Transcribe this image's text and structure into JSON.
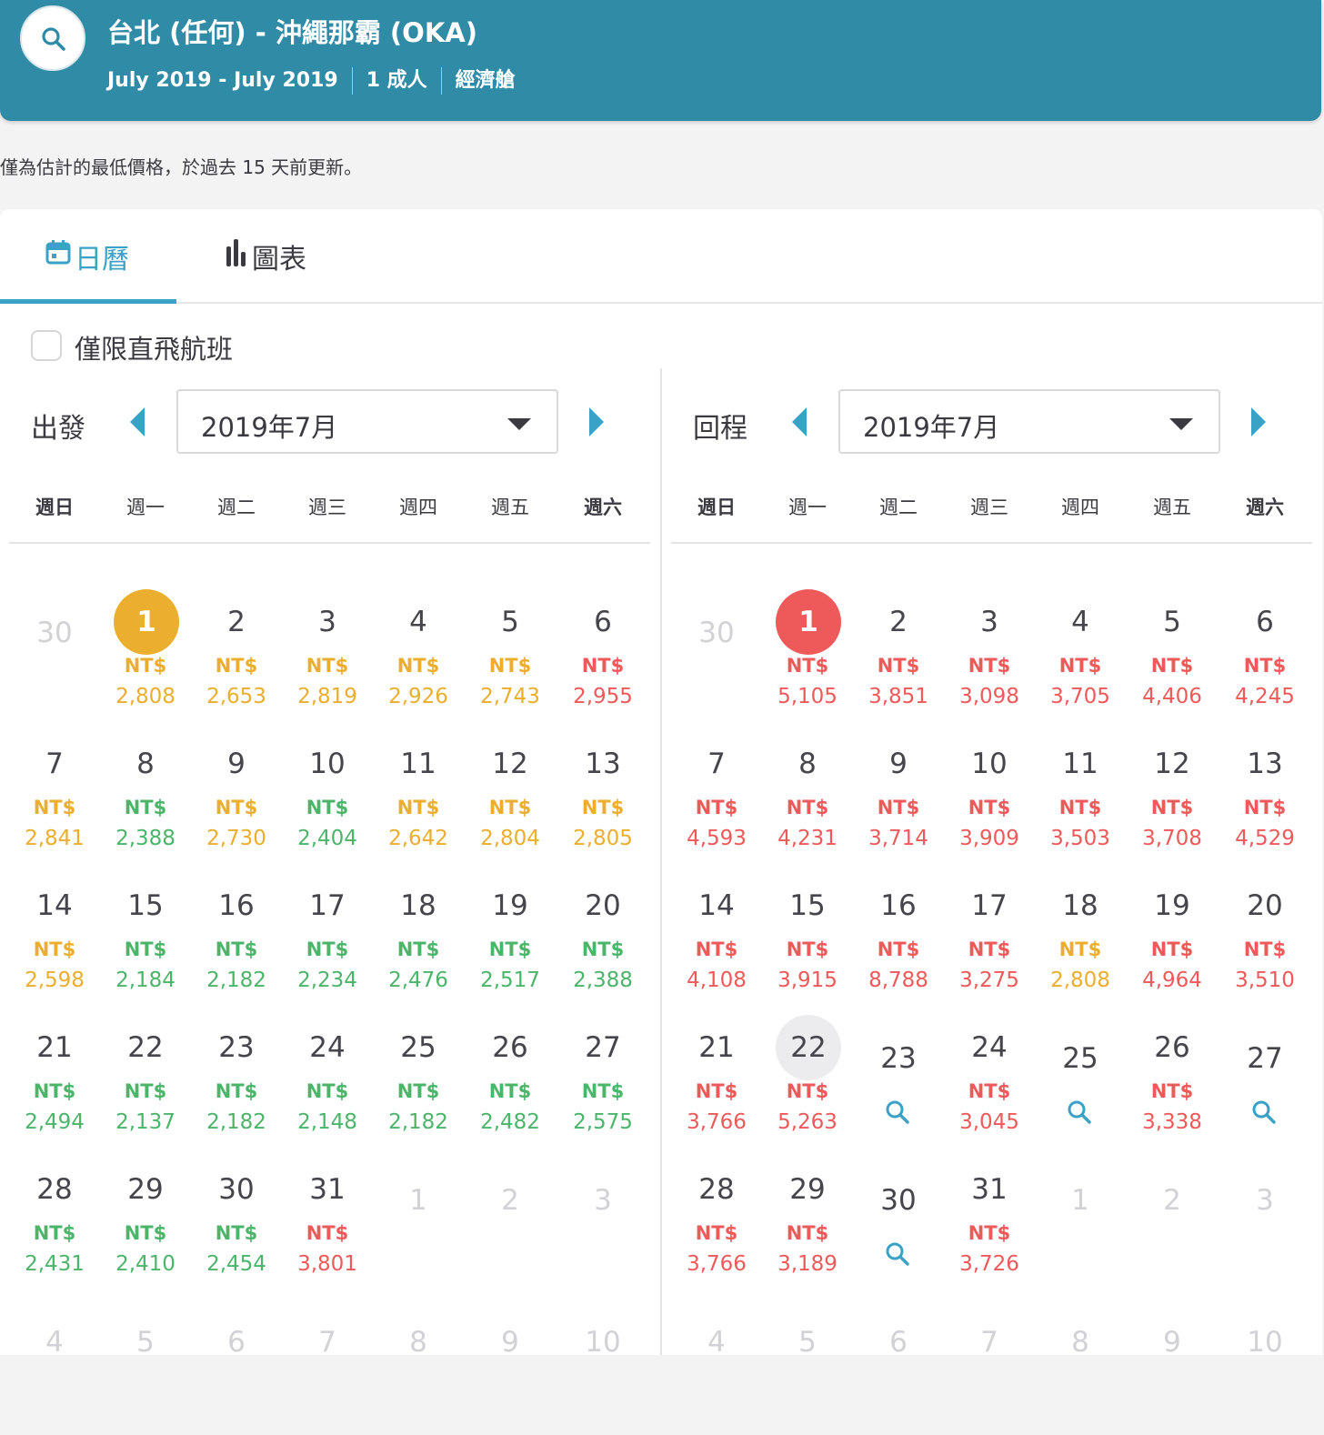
{
  "header": {
    "route": "台北 (任何) - 沖繩那霸 (OKA)",
    "dates": "July 2019 - July 2019",
    "passengers": "1 成人",
    "cabin": "經濟艙"
  },
  "notice": "僅為估計的最低價格，於過去 15 天前更新。",
  "tabs": {
    "calendar": "日曆",
    "chart": "圖表"
  },
  "filter": {
    "direct_only": "僅限直飛航班",
    "checked": false
  },
  "colors": {
    "header_bg": "#2f8ba6",
    "accent": "#3aa2c6",
    "low": "#4bb56a",
    "mid": "#ecae2e",
    "high": "#ee5a5a"
  },
  "weekdays": [
    "週日",
    "週一",
    "週二",
    "週三",
    "週四",
    "週五",
    "週六"
  ],
  "calendars": [
    {
      "label": "出發",
      "month": "2019年7月",
      "selected_color": "#ecae2e",
      "weeks": [
        [
          {
            "d": "30",
            "o": 1
          },
          {
            "d": "1",
            "p": "2,808",
            "c": "o",
            "s": 1
          },
          {
            "d": "2",
            "p": "2,653",
            "c": "o"
          },
          {
            "d": "3",
            "p": "2,819",
            "c": "o"
          },
          {
            "d": "4",
            "p": "2,926",
            "c": "o"
          },
          {
            "d": "5",
            "p": "2,743",
            "c": "o"
          },
          {
            "d": "6",
            "p": "2,955",
            "c": "r"
          }
        ],
        [
          {
            "d": "7",
            "p": "2,841",
            "c": "o"
          },
          {
            "d": "8",
            "p": "2,388",
            "c": "g"
          },
          {
            "d": "9",
            "p": "2,730",
            "c": "o"
          },
          {
            "d": "10",
            "p": "2,404",
            "c": "g"
          },
          {
            "d": "11",
            "p": "2,642",
            "c": "o"
          },
          {
            "d": "12",
            "p": "2,804",
            "c": "o"
          },
          {
            "d": "13",
            "p": "2,805",
            "c": "o"
          }
        ],
        [
          {
            "d": "14",
            "p": "2,598",
            "c": "o"
          },
          {
            "d": "15",
            "p": "2,184",
            "c": "g"
          },
          {
            "d": "16",
            "p": "2,182",
            "c": "g"
          },
          {
            "d": "17",
            "p": "2,234",
            "c": "g"
          },
          {
            "d": "18",
            "p": "2,476",
            "c": "g"
          },
          {
            "d": "19",
            "p": "2,517",
            "c": "g"
          },
          {
            "d": "20",
            "p": "2,388",
            "c": "g"
          }
        ],
        [
          {
            "d": "21",
            "p": "2,494",
            "c": "g"
          },
          {
            "d": "22",
            "p": "2,137",
            "c": "g"
          },
          {
            "d": "23",
            "p": "2,182",
            "c": "g"
          },
          {
            "d": "24",
            "p": "2,148",
            "c": "g"
          },
          {
            "d": "25",
            "p": "2,182",
            "c": "g"
          },
          {
            "d": "26",
            "p": "2,482",
            "c": "g"
          },
          {
            "d": "27",
            "p": "2,575",
            "c": "g"
          }
        ],
        [
          {
            "d": "28",
            "p": "2,431",
            "c": "g"
          },
          {
            "d": "29",
            "p": "2,410",
            "c": "g"
          },
          {
            "d": "30",
            "p": "2,454",
            "c": "g"
          },
          {
            "d": "31",
            "p": "3,801",
            "c": "r"
          },
          {
            "d": "1",
            "o": 1
          },
          {
            "d": "2",
            "o": 1
          },
          {
            "d": "3",
            "o": 1
          }
        ],
        [
          {
            "d": "4",
            "o": 1
          },
          {
            "d": "5",
            "o": 1
          },
          {
            "d": "6",
            "o": 1
          },
          {
            "d": "7",
            "o": 1
          },
          {
            "d": "8",
            "o": 1
          },
          {
            "d": "9",
            "o": 1
          },
          {
            "d": "10",
            "o": 1
          }
        ]
      ]
    },
    {
      "label": "回程",
      "month": "2019年7月",
      "selected_color": "#ee5a5a",
      "weeks": [
        [
          {
            "d": "30",
            "o": 1
          },
          {
            "d": "1",
            "p": "5,105",
            "c": "r",
            "s": 1
          },
          {
            "d": "2",
            "p": "3,851",
            "c": "r"
          },
          {
            "d": "3",
            "p": "3,098",
            "c": "r"
          },
          {
            "d": "4",
            "p": "3,705",
            "c": "r"
          },
          {
            "d": "5",
            "p": "4,406",
            "c": "r"
          },
          {
            "d": "6",
            "p": "4,245",
            "c": "r"
          }
        ],
        [
          {
            "d": "7",
            "p": "4,593",
            "c": "r"
          },
          {
            "d": "8",
            "p": "4,231",
            "c": "r"
          },
          {
            "d": "9",
            "p": "3,714",
            "c": "r"
          },
          {
            "d": "10",
            "p": "3,909",
            "c": "r"
          },
          {
            "d": "11",
            "p": "3,503",
            "c": "r"
          },
          {
            "d": "12",
            "p": "3,708",
            "c": "r"
          },
          {
            "d": "13",
            "p": "4,529",
            "c": "r"
          }
        ],
        [
          {
            "d": "14",
            "p": "4,108",
            "c": "r"
          },
          {
            "d": "15",
            "p": "3,915",
            "c": "r"
          },
          {
            "d": "16",
            "p": "8,788",
            "c": "r"
          },
          {
            "d": "17",
            "p": "3,275",
            "c": "r"
          },
          {
            "d": "18",
            "p": "2,808",
            "c": "o"
          },
          {
            "d": "19",
            "p": "4,964",
            "c": "r"
          },
          {
            "d": "20",
            "p": "3,510",
            "c": "r"
          }
        ],
        [
          {
            "d": "21",
            "p": "3,766",
            "c": "r"
          },
          {
            "d": "22",
            "p": "5,263",
            "c": "r",
            "h": 1
          },
          {
            "d": "23",
            "q": 1
          },
          {
            "d": "24",
            "p": "3,045",
            "c": "r"
          },
          {
            "d": "25",
            "q": 1
          },
          {
            "d": "26",
            "p": "3,338",
            "c": "r"
          },
          {
            "d": "27",
            "q": 1
          }
        ],
        [
          {
            "d": "28",
            "p": "3,766",
            "c": "r"
          },
          {
            "d": "29",
            "p": "3,189",
            "c": "r"
          },
          {
            "d": "30",
            "q": 1
          },
          {
            "d": "31",
            "p": "3,726",
            "c": "r"
          },
          {
            "d": "1",
            "o": 1
          },
          {
            "d": "2",
            "o": 1
          },
          {
            "d": "3",
            "o": 1
          }
        ],
        [
          {
            "d": "4",
            "o": 1
          },
          {
            "d": "5",
            "o": 1
          },
          {
            "d": "6",
            "o": 1
          },
          {
            "d": "7",
            "o": 1
          },
          {
            "d": "8",
            "o": 1
          },
          {
            "d": "9",
            "o": 1
          },
          {
            "d": "10",
            "o": 1
          }
        ]
      ]
    }
  ],
  "currency": "NT$"
}
